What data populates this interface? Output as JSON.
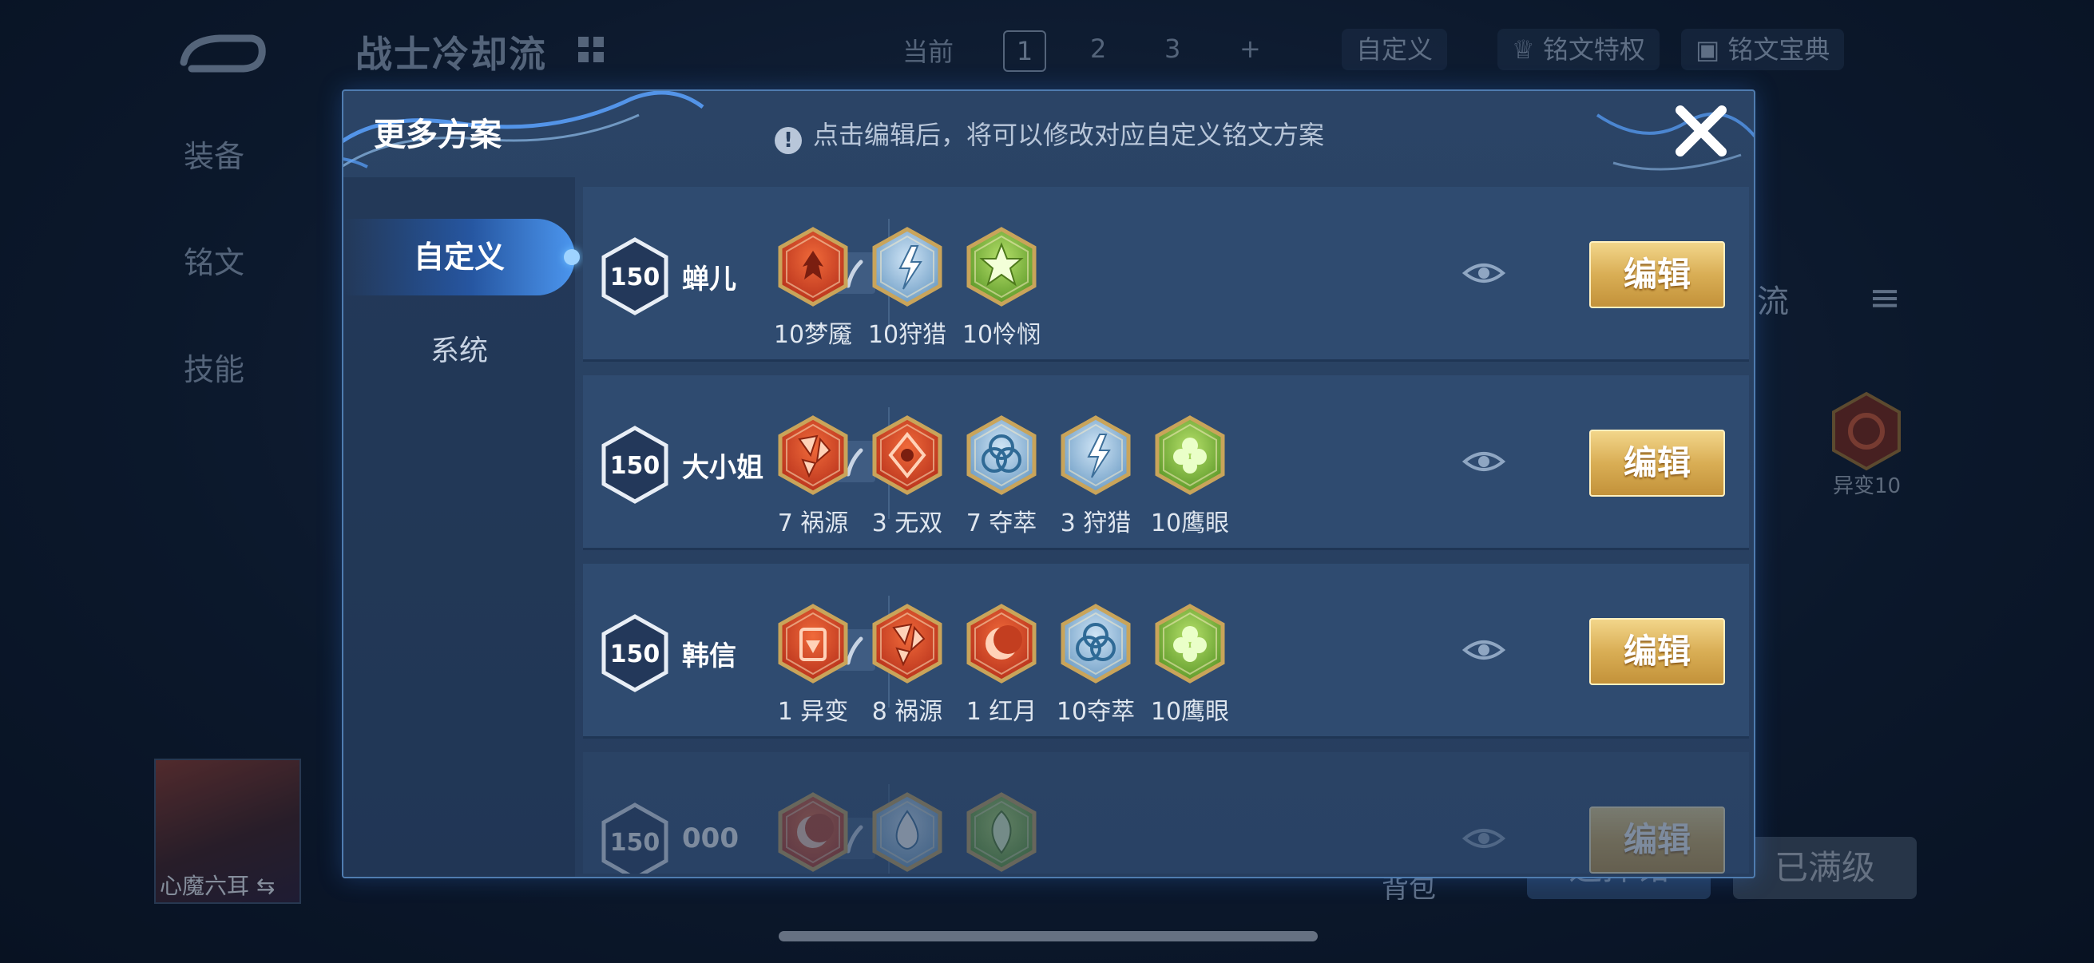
{
  "background": {
    "title": "战士冷却流",
    "current_label": "当前",
    "plan_tabs": [
      "1",
      "2",
      "3",
      "+"
    ],
    "custom_label": "自定义",
    "privilege_label": "铭文特权",
    "dictionary_label": "铭文宝典",
    "left_nav": [
      "装备",
      "铭文",
      "技能"
    ],
    "hero_name": "心魔六耳",
    "right_partial_label": "却流",
    "rune_label": "异变10",
    "bag_label": "背包",
    "choose_button": "选择铭",
    "maxed_button": "已满级"
  },
  "modal": {
    "title": "更多方案",
    "hint": "点击编辑后，将可以修改对应自定义铭文方案",
    "hint_icon": "info-icon",
    "close_icon": "close-icon",
    "tabs": [
      {
        "label": "自定义",
        "active": true
      },
      {
        "label": "系统",
        "active": false
      }
    ]
  },
  "plans": [
    {
      "level": "150",
      "name": "蝉儿",
      "edit_label": "编辑",
      "runes": [
        {
          "label": "10梦魇",
          "color": "red",
          "icon": "flame-crest-icon"
        },
        {
          "label": "10狩猎",
          "color": "blue",
          "icon": "lightning-icon"
        },
        {
          "label": "10怜悯",
          "color": "green",
          "icon": "star-icon"
        }
      ]
    },
    {
      "level": "150",
      "name": "大小姐",
      "edit_label": "编辑",
      "runes": [
        {
          "label": "7 祸源",
          "color": "red",
          "icon": "shards-icon"
        },
        {
          "label": "3 无双",
          "color": "red",
          "icon": "diamond-spiral-icon"
        },
        {
          "label": "7 夺萃",
          "color": "blue",
          "icon": "triquetra-icon"
        },
        {
          "label": "3 狩猎",
          "color": "blue",
          "icon": "lightning-icon"
        },
        {
          "label": "10鹰眼",
          "color": "green",
          "icon": "clover-icon"
        }
      ]
    },
    {
      "level": "150",
      "name": "韩信",
      "edit_label": "编辑",
      "runes": [
        {
          "label": "1 异变",
          "color": "red",
          "icon": "gate-icon"
        },
        {
          "label": "8 祸源",
          "color": "red",
          "icon": "shards-icon"
        },
        {
          "label": "1 红月",
          "color": "red",
          "icon": "crescent-icon"
        },
        {
          "label": "10夺萃",
          "color": "blue",
          "icon": "triquetra-icon"
        },
        {
          "label": "10鹰眼",
          "color": "green",
          "icon": "clover-icon"
        }
      ]
    },
    {
      "level": "150",
      "name": "000",
      "edit_label": "编辑",
      "runes": [
        {
          "label": "",
          "color": "red",
          "icon": "crescent-icon"
        },
        {
          "label": "",
          "color": "blue",
          "icon": "water-drop-icon"
        },
        {
          "label": "",
          "color": "green",
          "icon": "leaf-icon"
        }
      ]
    }
  ],
  "colors": {
    "red": "#d8542a",
    "blue": "#8fb6d6",
    "green": "#8fc24a",
    "gold": "#d9ae55"
  }
}
